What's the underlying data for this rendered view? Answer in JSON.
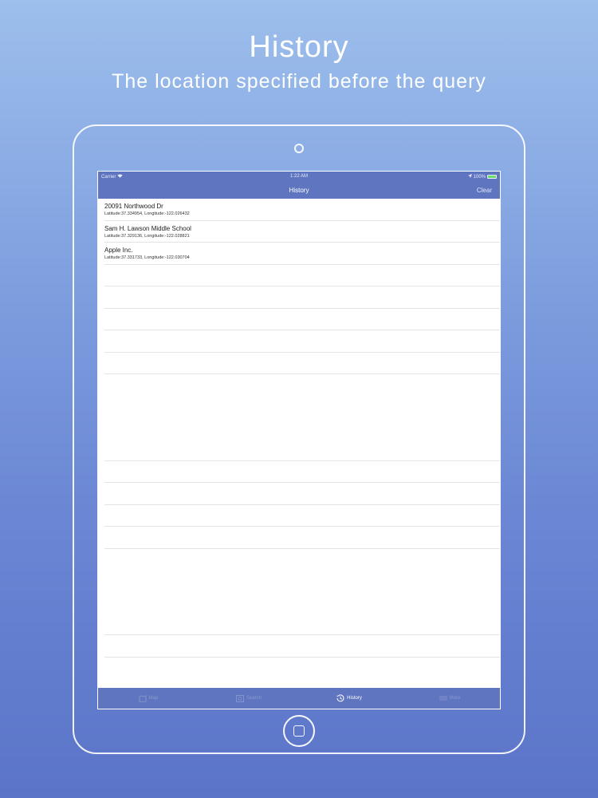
{
  "promo": {
    "title": "History",
    "subtitle": "The location specified before the query"
  },
  "status_bar": {
    "carrier": "Carrier",
    "time": "1:22 AM",
    "battery": "100%"
  },
  "nav_bar": {
    "title": "History",
    "clear_label": "Clear"
  },
  "history": {
    "items": [
      {
        "title": "20091 Northwood Dr",
        "coords": "Latitude:37.334954, Longitude:-122.026432"
      },
      {
        "title": "Sam H. Lawson Middle School",
        "coords": "Latitude:37.329136, Longitude:-122.028821"
      },
      {
        "title": "Apple Inc.",
        "coords": "Latitude:37.331733, Longitude:-122.030704"
      }
    ]
  },
  "tab_bar": {
    "tabs": [
      {
        "label": "Map",
        "icon": "map-icon",
        "active": false
      },
      {
        "label": "Search",
        "icon": "search-icon",
        "active": false
      },
      {
        "label": "History",
        "icon": "history-icon",
        "active": true
      },
      {
        "label": "More",
        "icon": "more-icon",
        "active": false
      }
    ]
  },
  "colors": {
    "bar": "#5f75bf",
    "background_top": "#9dbfec",
    "background_bottom": "#5b74c8"
  }
}
